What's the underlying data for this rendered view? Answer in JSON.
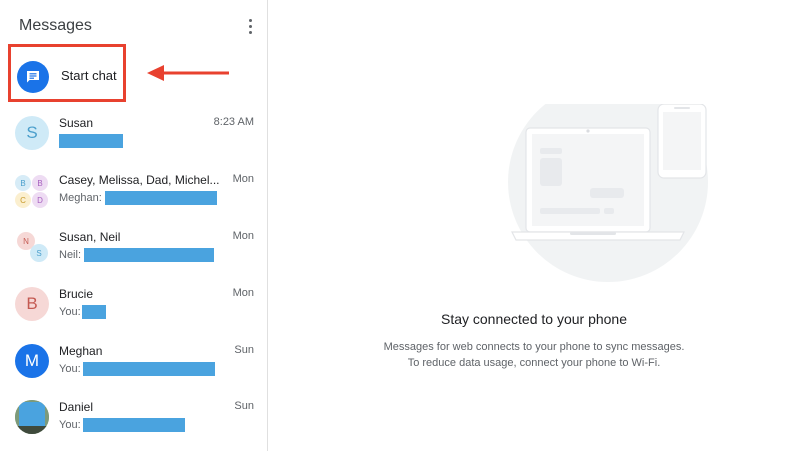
{
  "sidebar": {
    "title": "Messages",
    "start_chat_label": "Start chat",
    "conversations": [
      {
        "name": "Susan",
        "time": "8:23 AM",
        "prefix": "",
        "avatar_letter": "S"
      },
      {
        "name": "Casey, Melissa, Dad, Michel...",
        "time": "Mon",
        "prefix": "Meghan:",
        "avatar_letters": [
          "B",
          "B",
          "C",
          "D"
        ]
      },
      {
        "name": "Susan, Neil",
        "time": "Mon",
        "prefix": "Neil:",
        "avatar_letters": [
          "N",
          "S"
        ]
      },
      {
        "name": "Brucie",
        "time": "Mon",
        "prefix": "You:",
        "avatar_letter": "B"
      },
      {
        "name": "Meghan",
        "time": "Sun",
        "prefix": "You:",
        "avatar_letter": "M"
      },
      {
        "name": "Daniel",
        "time": "Sun",
        "prefix": "You:",
        "avatar_letter": ""
      }
    ]
  },
  "main": {
    "heading": "Stay connected to your phone",
    "line1": "Messages for web connects to your phone to sync messages.",
    "line2": "To reduce data usage, connect your phone to Wi-Fi."
  },
  "colors": {
    "accent": "#1a73e8",
    "annotation": "#e8412f",
    "redaction": "#4aa3df"
  },
  "icons": {
    "start_chat": "chat-bubble-icon",
    "menu": "more-vert-icon",
    "annotation": "arrow-left-icon"
  }
}
